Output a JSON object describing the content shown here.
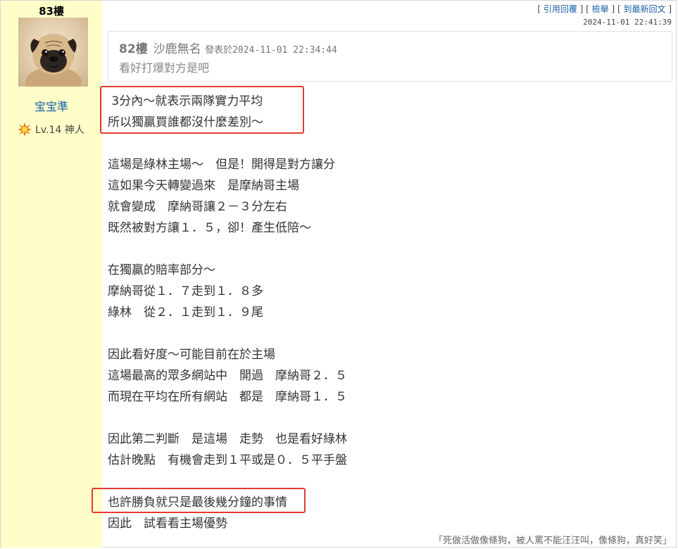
{
  "post": {
    "floor_label": "83樓",
    "author": {
      "username": "宝宝準",
      "level_text": "Lv.14 神人",
      "avatar_alt": "pug avatar"
    },
    "actions": {
      "quote_reply": "引用回覆",
      "report": "檢舉",
      "go_newest": "到最新回文"
    },
    "timestamp": "2024-11-01 22:41:39",
    "quote": {
      "floor": "82樓",
      "author": "沙鹿無名",
      "posted_label": "發表於",
      "date": "2024-11-01 22:34:44",
      "text": "看好打爆對方是吧"
    },
    "body_lines": [
      " 3分內～就表示兩隊實力平均",
      "所以獨贏買誰都沒什麼差別～",
      "",
      "這場是綠林主場～　但是！開得是對方讓分",
      "這如果今天轉變過來　是摩納哥主場",
      "就會變成　摩納哥讓２－３分左右",
      "既然被對方讓１．５，卻！產生低陪～",
      "",
      "在獨贏的賠率部分～",
      "摩納哥從１．７走到１．８多",
      "綠林　從２．１走到１．９尾",
      "",
      "因此看好度～可能目前在於主場",
      "這場最高的眾多網站中　開過　摩納哥２．５",
      "而現在平均在所有網站　都是　摩納哥１．５",
      "",
      "因此第二判斷　是這場　走勢　也是看好綠林",
      "估計晚點　有機會走到１平或是０．５平手盤",
      "",
      "也許勝負就只是最後幾分鐘的事情",
      "因此　試看看主場優勢"
    ],
    "signature": "「死做活做像條狗，被人罵不能汪汪叫，像條狗，真好笑」"
  },
  "colors": {
    "sidebar_bg": "#fefec8",
    "link": "#1a5ea8",
    "highlight_border": "#e53935"
  }
}
